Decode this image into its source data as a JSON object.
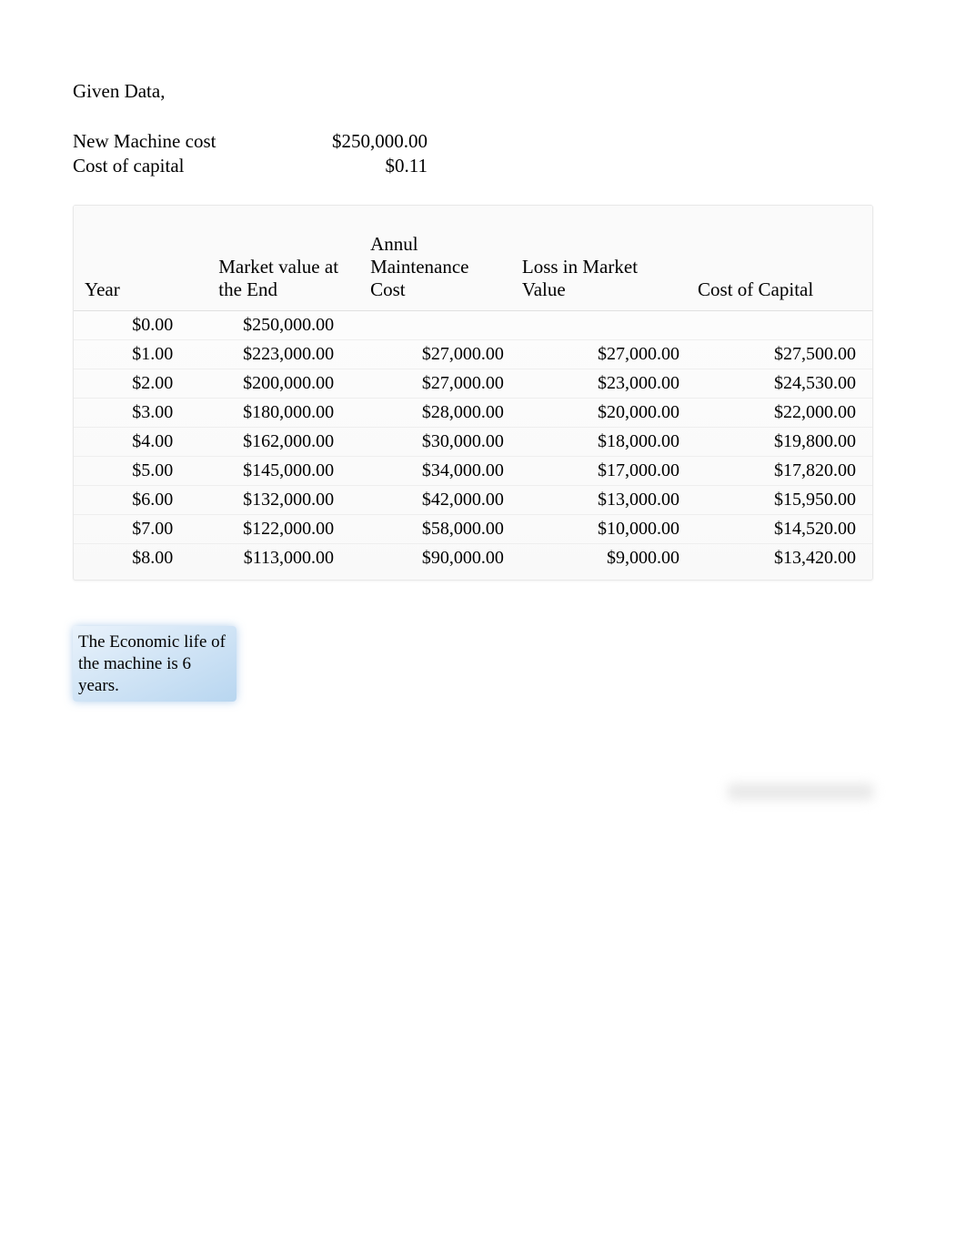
{
  "header": "Given Data,",
  "params": {
    "machine_cost_label": "New Machine cost",
    "machine_cost_value": "$250,000.00",
    "cost_of_capital_label": "Cost of capital",
    "cost_of_capital_value": "$0.11"
  },
  "chart_data": {
    "type": "table",
    "columns": [
      "Year",
      "Market value at the End",
      "Annul Maintenance Cost",
      "Loss in Market Value",
      "Cost of Capital"
    ],
    "rows": [
      {
        "year": "$0.00",
        "mv": "$250,000.00",
        "amc": "",
        "loss": "",
        "coc": ""
      },
      {
        "year": "$1.00",
        "mv": "$223,000.00",
        "amc": "$27,000.00",
        "loss": "$27,000.00",
        "coc": "$27,500.00"
      },
      {
        "year": "$2.00",
        "mv": "$200,000.00",
        "amc": "$27,000.00",
        "loss": "$23,000.00",
        "coc": "$24,530.00"
      },
      {
        "year": "$3.00",
        "mv": "$180,000.00",
        "amc": "$28,000.00",
        "loss": "$20,000.00",
        "coc": "$22,000.00"
      },
      {
        "year": "$4.00",
        "mv": "$162,000.00",
        "amc": "$30,000.00",
        "loss": "$18,000.00",
        "coc": "$19,800.00"
      },
      {
        "year": "$5.00",
        "mv": "$145,000.00",
        "amc": "$34,000.00",
        "loss": "$17,000.00",
        "coc": "$17,820.00"
      },
      {
        "year": "$6.00",
        "mv": "$132,000.00",
        "amc": "$42,000.00",
        "loss": "$13,000.00",
        "coc": "$15,950.00"
      },
      {
        "year": "$7.00",
        "mv": "$122,000.00",
        "amc": "$58,000.00",
        "loss": "$10,000.00",
        "coc": "$14,520.00"
      },
      {
        "year": "$8.00",
        "mv": "$113,000.00",
        "amc": "$90,000.00",
        "loss": "$9,000.00",
        "coc": "$13,420.00"
      }
    ]
  },
  "conclusion": "The Economic life of the machine is 6 years."
}
